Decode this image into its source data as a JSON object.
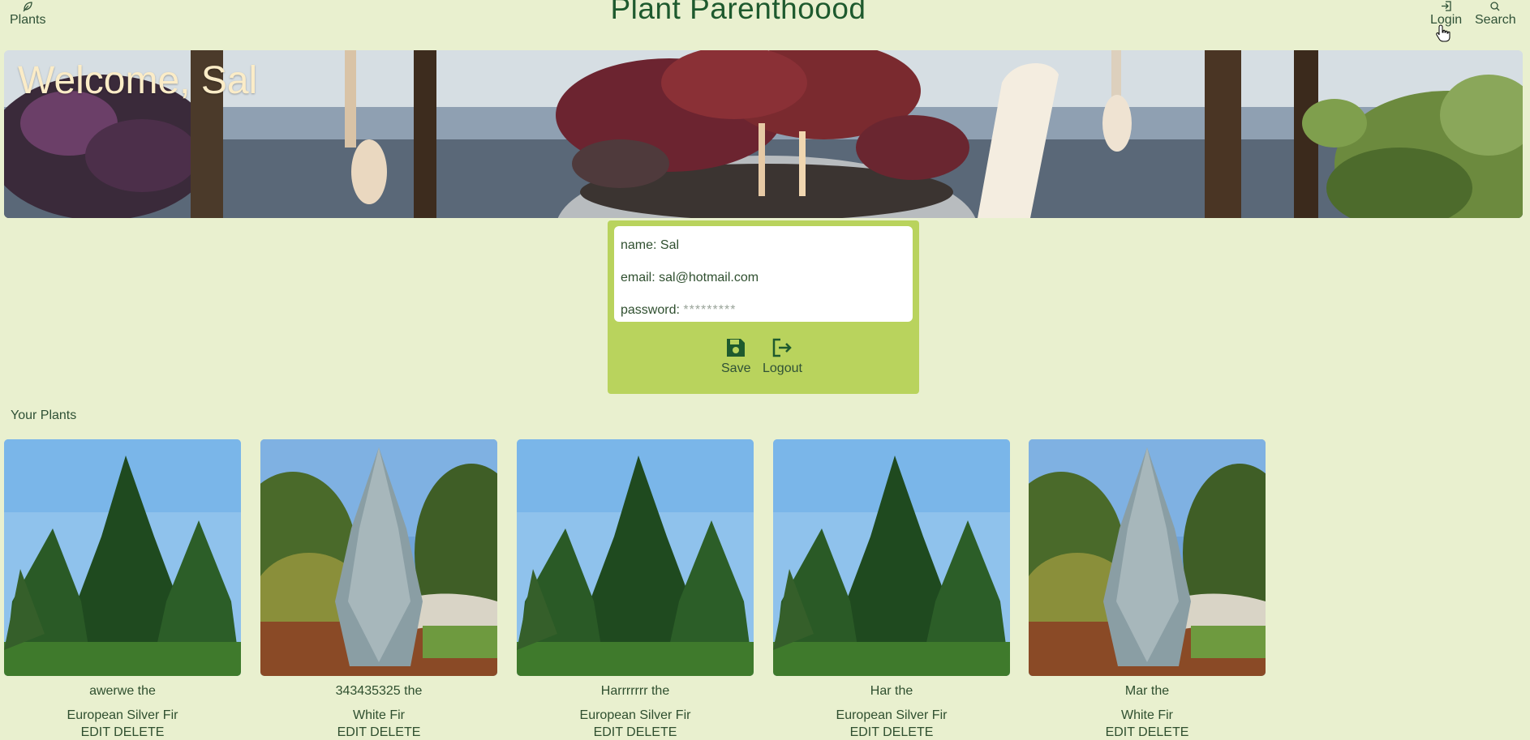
{
  "nav": {
    "plants_label": "Plants",
    "brand": "Plant Parenthoood",
    "login_label": "Login",
    "search_label": "Search"
  },
  "hero": {
    "title": "Welcome, Sal"
  },
  "profile": {
    "name_label": "name:",
    "name_value": "Sal",
    "email_label": "email:",
    "email_value": "sal@hotmail.com",
    "password_label": "password:",
    "password_value": "*********",
    "save_label": "Save",
    "logout_label": "Logout"
  },
  "your_plants_label": "Your Plants",
  "plants": [
    {
      "name": "awerwe the",
      "species": "European Silver Fir",
      "edit": "EDIT",
      "delete": "DELETE",
      "image": "european-silver-fir"
    },
    {
      "name": "343435325 the",
      "species": "White Fir",
      "edit": "EDIT",
      "delete": "DELETE",
      "image": "white-fir"
    },
    {
      "name": "Harrrrrrr the",
      "species": "European Silver Fir",
      "edit": "EDIT",
      "delete": "DELETE",
      "image": "european-silver-fir"
    },
    {
      "name": "Har the",
      "species": "European Silver Fir",
      "edit": "EDIT",
      "delete": "DELETE",
      "image": "european-silver-fir"
    },
    {
      "name": "Mar the",
      "species": "White Fir",
      "edit": "EDIT",
      "delete": "DELETE",
      "image": "white-fir"
    }
  ],
  "colors": {
    "background": "#e9f0cf",
    "card": "#b9d35d",
    "brand_text": "#1e5a2e",
    "hero_title": "#fbecc7"
  }
}
